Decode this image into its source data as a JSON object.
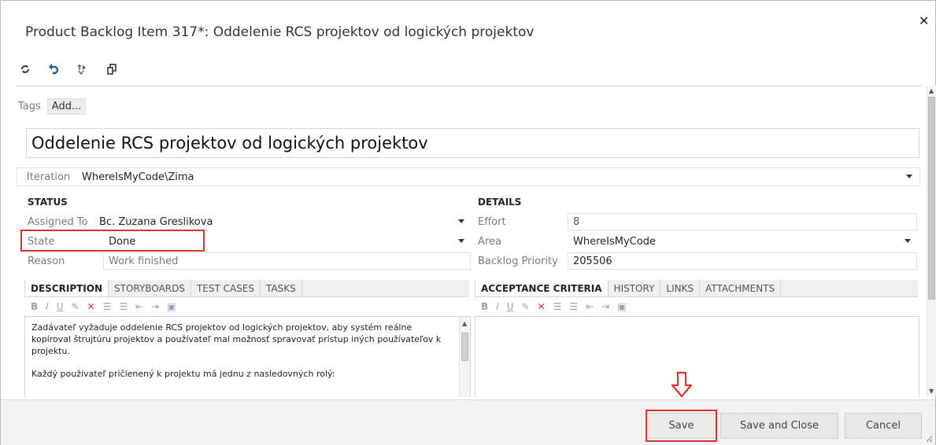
{
  "dialog": {
    "title": "Product Backlog Item 317*: Oddelenie RCS projektov od logických projektov",
    "close_icon": "close-icon"
  },
  "toolbar": {
    "refresh_icon": "refresh-icon",
    "undo_icon": "undo-icon",
    "link_icon": "new-linked-item-icon",
    "copy_icon": "copy-icon"
  },
  "tags": {
    "label": "Tags",
    "add_label": "Add..."
  },
  "work_item": {
    "title": "Oddelenie RCS projektov od logických projektov"
  },
  "iteration": {
    "label": "Iteration",
    "value": "WhereIsMyCode\\Zima"
  },
  "status": {
    "heading": "STATUS",
    "assigned_to_label": "Assigned To",
    "assigned_to_value": "Bc. Zuzana Greslikova",
    "state_label": "State",
    "state_value": "Done",
    "reason_label": "Reason",
    "reason_value": "Work finished"
  },
  "details": {
    "heading": "DETAILS",
    "effort_label": "Effort",
    "effort_value": "8",
    "area_label": "Area",
    "area_value": "WhereIsMyCode",
    "priority_label": "Backlog Priority",
    "priority_value": "205506"
  },
  "left_tabs": [
    {
      "label": "DESCRIPTION",
      "active": true
    },
    {
      "label": "STORYBOARDS",
      "active": false
    },
    {
      "label": "TEST CASES",
      "active": false
    },
    {
      "label": "TASKS",
      "active": false
    }
  ],
  "right_tabs": [
    {
      "label": "ACCEPTANCE CRITERIA",
      "active": true
    },
    {
      "label": "HISTORY",
      "active": false
    },
    {
      "label": "LINKS",
      "active": false
    },
    {
      "label": "ATTACHMENTS",
      "active": false
    }
  ],
  "rte_toolbar": {
    "bold": "B",
    "italic": "I",
    "underline": "U"
  },
  "description": {
    "paragraph1": "Zadávateľ vyžaduje oddelenie RCS projektov od logických projektov, aby systém reálne kopíroval štrujtúru projektov a používateľ mal možnosť spravovať prístup iných používateľov k projektu.",
    "paragraph2": "Každý používateľ pričlenený k projektu má jednu z nasledovných rolý:"
  },
  "footer": {
    "save_label": "Save",
    "save_close_label": "Save and Close",
    "cancel_label": "Cancel"
  },
  "colors": {
    "highlight": "#e03030",
    "accent_blue": "#1e5fa8"
  }
}
